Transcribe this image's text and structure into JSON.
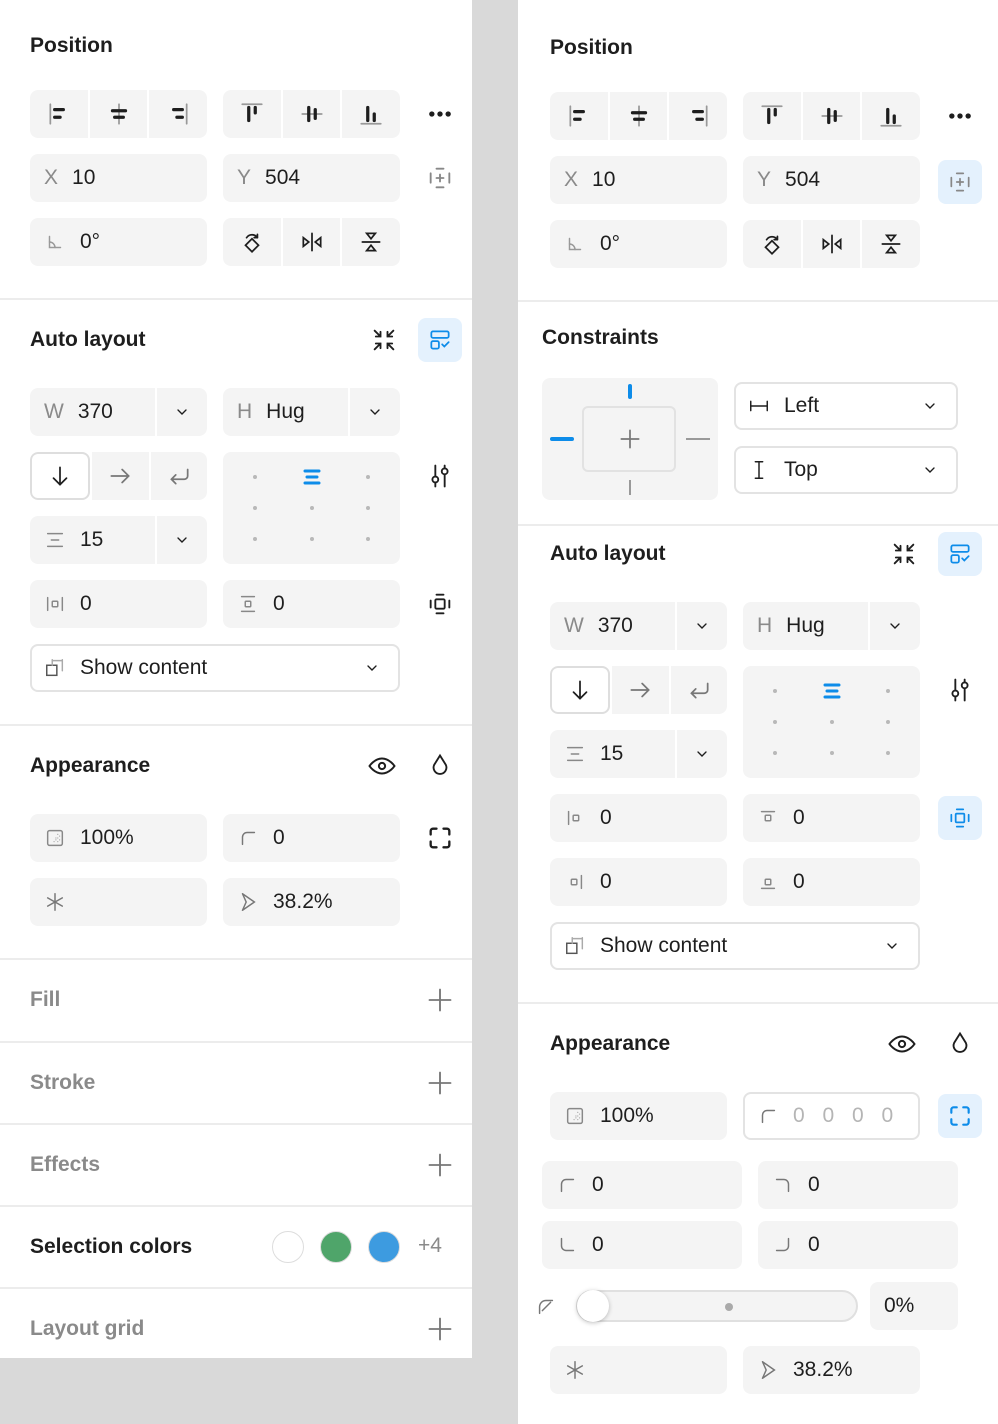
{
  "left": {
    "position": {
      "title": "Position",
      "x_label": "X",
      "x": "10",
      "y_label": "Y",
      "y": "504",
      "rotation": "0°"
    },
    "auto_layout": {
      "title": "Auto layout",
      "w_label": "W",
      "w": "370",
      "h_label": "H",
      "h": "Hug",
      "gap": "15",
      "padding_horizontal": "0",
      "padding_vertical": "0",
      "clip": "Show content"
    },
    "appearance": {
      "title": "Appearance",
      "opacity": "100%",
      "radius": "0",
      "smoothing": "38.2%"
    },
    "fill": {
      "title": "Fill"
    },
    "stroke": {
      "title": "Stroke"
    },
    "effects": {
      "title": "Effects"
    },
    "selection_colors": {
      "title": "Selection colors",
      "swatches": [
        "#ffffff",
        "#4fa56a",
        "#3d9be0"
      ],
      "more": "+4"
    },
    "layout_grid": {
      "title": "Layout grid"
    }
  },
  "right": {
    "position": {
      "title": "Position",
      "x_label": "X",
      "x": "10",
      "y_label": "Y",
      "y": "504",
      "rotation": "0°"
    },
    "constraints": {
      "title": "Constraints",
      "horizontal": "Left",
      "vertical": "Top"
    },
    "auto_layout": {
      "title": "Auto layout",
      "w_label": "W",
      "w": "370",
      "h_label": "H",
      "h": "Hug",
      "gap": "15",
      "padding_left": "0",
      "padding_top": "0",
      "padding_right": "0",
      "padding_bottom": "0",
      "clip": "Show content"
    },
    "appearance": {
      "title": "Appearance",
      "opacity": "100%",
      "radius_placeholder": "0 0 0 0",
      "radius_top_left": "0",
      "radius_top_right": "0",
      "radius_bottom_left": "0",
      "radius_bottom_right": "0",
      "corner_smoothing": "0%",
      "corner_smoothing_value": 0,
      "smoothing": "38.2%"
    }
  },
  "colors": {
    "accent": "#0d8ce9",
    "accent_bg": "#e4f1fd",
    "field_bg": "#f4f4f4"
  }
}
